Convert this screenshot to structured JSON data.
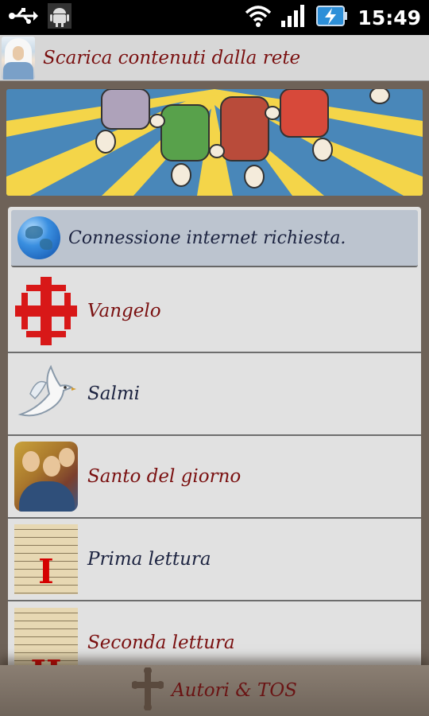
{
  "status_bar": {
    "time": "15:49",
    "icons": [
      "usb-icon",
      "android-debug-icon",
      "wifi-icon",
      "signal-icon",
      "battery-charging-icon"
    ]
  },
  "title_bar": {
    "title": "Scarica contenuti dalla rete",
    "icon": "madonna-icon"
  },
  "card": {
    "header": "Connessione internet richiesta.",
    "header_icon": "globe-icon",
    "items": [
      {
        "label": "Vangelo",
        "icon": "cross-icon",
        "color": "#7a1010"
      },
      {
        "label": "Salmi",
        "icon": "dove-icon",
        "color": "#1c2340"
      },
      {
        "label": "Santo del giorno",
        "icon": "saint-icon",
        "color": "#7a1010"
      },
      {
        "label": "Prima lettura",
        "icon": "manuscript-icon",
        "numeral": "I",
        "color": "#1c2340"
      },
      {
        "label": "Seconda lettura",
        "icon": "manuscript-icon",
        "numeral": "II",
        "color": "#7a1010"
      }
    ]
  },
  "bottom_bar": {
    "label": "Autori & TOS",
    "icon": "cross-icon"
  },
  "colors": {
    "accent_red": "#7a1010",
    "accent_navy": "#1c2340",
    "background": "#6e6258"
  }
}
